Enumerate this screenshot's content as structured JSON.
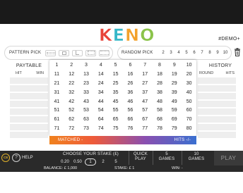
{
  "logo": {
    "letters": [
      {
        "char": "K",
        "color": "#e8443a"
      },
      {
        "char": "E",
        "color": "#36b7c8"
      },
      {
        "char": "N",
        "color": "#f3a12b"
      },
      {
        "char": "O",
        "color": "#8bc34a"
      }
    ]
  },
  "demo_label": "#DEMO+",
  "pattern_pick": {
    "label": "PATTERN PICK",
    "icons": [
      "pattern-1-icon",
      "pattern-2-icon",
      "pattern-3-icon",
      "pattern-4-icon",
      "pattern-5-icon"
    ]
  },
  "random_pick": {
    "label": "RANDOM PICK",
    "numbers": [
      "2",
      "3",
      "4",
      "5",
      "6",
      "7",
      "8",
      "9",
      "10"
    ]
  },
  "clear_icon": "trash-icon",
  "paytable": {
    "title": "PAYTABLE",
    "col_hit": "HIT",
    "col_win": "WIN"
  },
  "history": {
    "title": "HISTORY",
    "col_round": "ROUND",
    "col_hits": "HITS"
  },
  "numbers": [
    "1",
    "2",
    "3",
    "4",
    "5",
    "6",
    "7",
    "8",
    "9",
    "10",
    "11",
    "12",
    "13",
    "14",
    "15",
    "16",
    "17",
    "18",
    "19",
    "20",
    "21",
    "22",
    "23",
    "24",
    "25",
    "26",
    "27",
    "28",
    "29",
    "30",
    "31",
    "32",
    "33",
    "34",
    "35",
    "36",
    "37",
    "38",
    "39",
    "40",
    "41",
    "42",
    "43",
    "44",
    "45",
    "46",
    "47",
    "48",
    "49",
    "50",
    "51",
    "52",
    "53",
    "54",
    "55",
    "56",
    "57",
    "58",
    "59",
    "60",
    "61",
    "62",
    "63",
    "64",
    "65",
    "66",
    "67",
    "68",
    "69",
    "70",
    "71",
    "72",
    "73",
    "74",
    "75",
    "76",
    "77",
    "78",
    "79",
    "80"
  ],
  "match_bar": {
    "matched": "MATCHED -",
    "hits": "HITS -/-"
  },
  "bottom": {
    "circle_label": "C8",
    "help": "HELP",
    "stake_title": "CHOOSE YOUR STAKE (£)",
    "stakes": [
      "0.20",
      "0.50",
      "1",
      "2",
      "5"
    ],
    "selected_stake": "1",
    "quick_play": [
      "QUICK",
      "PLAY"
    ],
    "five_games": [
      "5",
      "GAMES"
    ],
    "ten_games": [
      "10",
      "GAMES"
    ],
    "play": "PLAY"
  },
  "status": {
    "balance": "BALANCE: £ 1,000",
    "stake": "STAKE: £ 1",
    "win": "WIN: -"
  }
}
